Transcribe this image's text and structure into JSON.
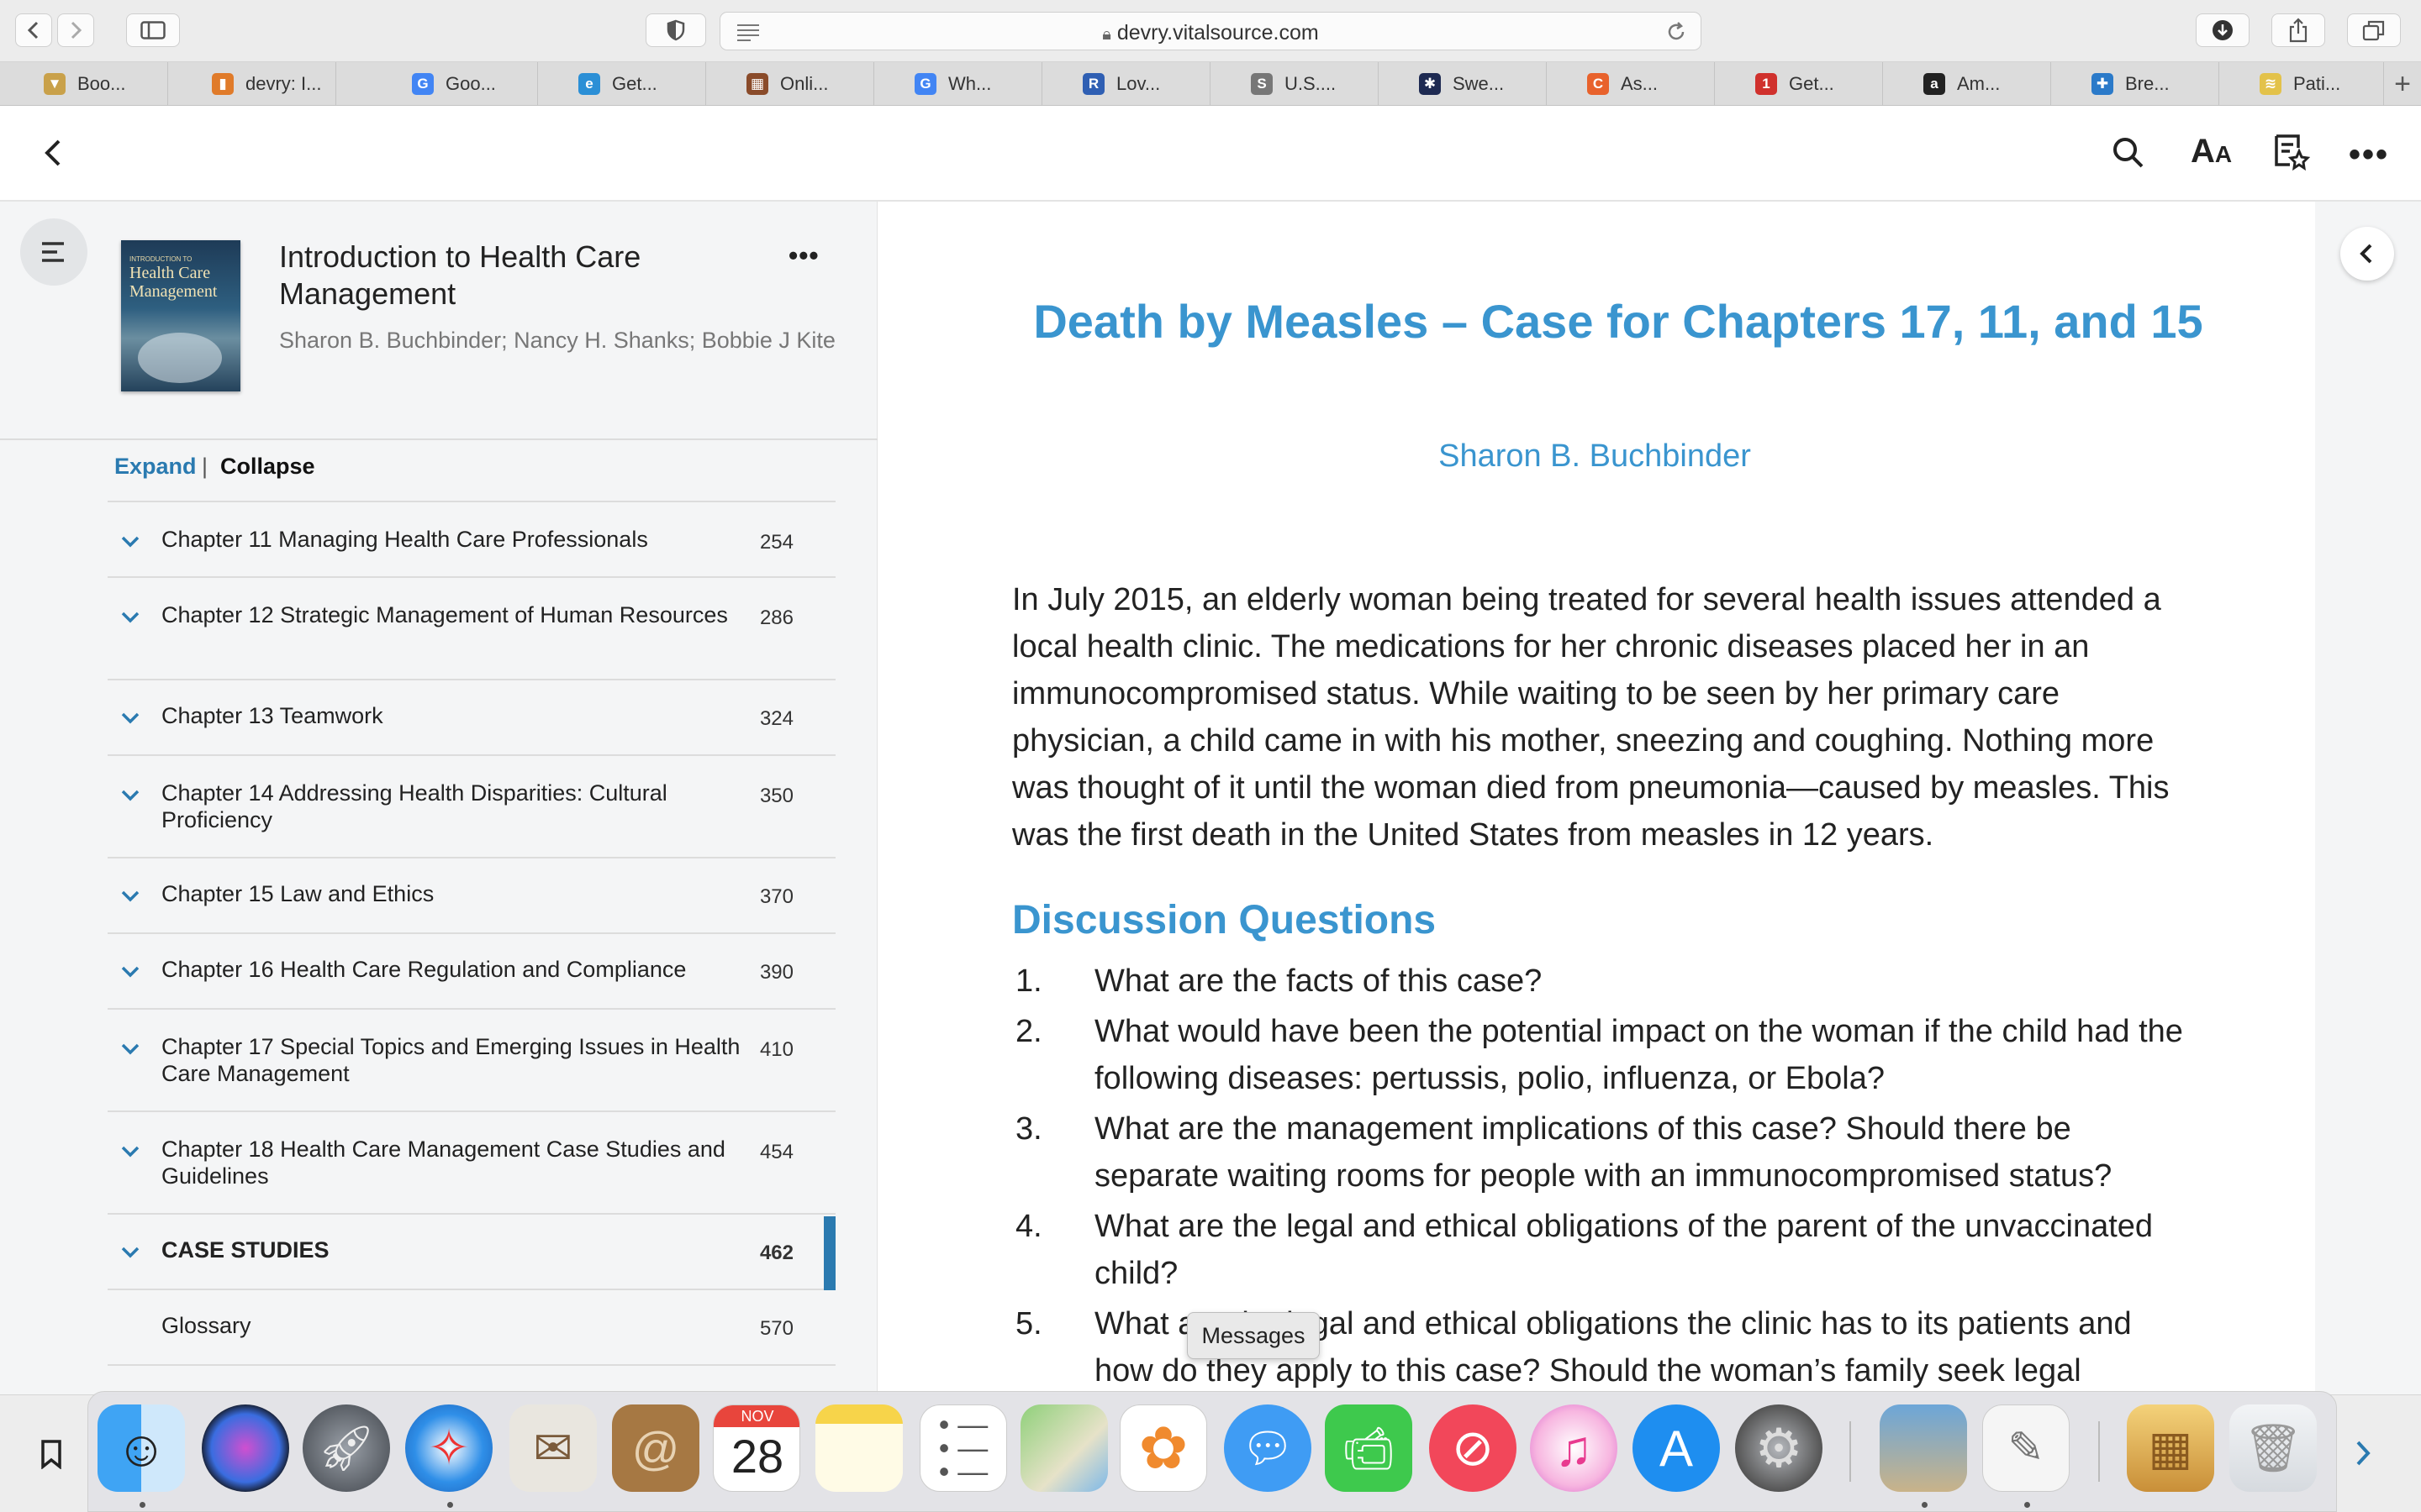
{
  "browser": {
    "url": "devry.vitalsource.com",
    "tabs": [
      {
        "label": "Boo...",
        "color": "#c9a14a",
        "glyph": "▼"
      },
      {
        "label": "devry: I...",
        "color": "#e07b2a",
        "glyph": "▮"
      },
      {
        "label": "Goo...",
        "color": "#4285f4",
        "glyph": "G"
      },
      {
        "label": "Get...",
        "color": "#2b8fd6",
        "glyph": "e"
      },
      {
        "label": "Onli...",
        "color": "#8a4b2a",
        "glyph": "▦"
      },
      {
        "label": "Wh...",
        "color": "#4285f4",
        "glyph": "G"
      },
      {
        "label": "Lov...",
        "color": "#2f5fb3",
        "glyph": "R"
      },
      {
        "label": "U.S....",
        "color": "#777777",
        "glyph": "S"
      },
      {
        "label": "Swe...",
        "color": "#1e2a52",
        "glyph": "✱"
      },
      {
        "label": "As...",
        "color": "#e8622c",
        "glyph": "C"
      },
      {
        "label": "Get...",
        "color": "#d0312d",
        "glyph": "1"
      },
      {
        "label": "Am...",
        "color": "#222222",
        "glyph": "a"
      },
      {
        "label": "Bre...",
        "color": "#2b7ac9",
        "glyph": "✚"
      },
      {
        "label": "Pati...",
        "color": "#e3c24a",
        "glyph": "≋"
      }
    ]
  },
  "book": {
    "title": "Introduction to Health Care Management",
    "authors": "Sharon B. Buchbinder; Nancy H. Shanks; Bobbie J Kite",
    "cover_lines": [
      "INTRODUCTION TO",
      "Health Care",
      "Management"
    ]
  },
  "toc": {
    "expand": "Expand",
    "separator": "|",
    "collapse": "Collapse",
    "items": [
      {
        "label": "Chapter 11 Managing Health Care Professionals",
        "page": "254"
      },
      {
        "label": "Chapter 12 Strategic Management of Human Resources",
        "page": "286"
      },
      {
        "label": "Chapter 13 Teamwork",
        "page": "324"
      },
      {
        "label": "Chapter 14 Addressing Health Disparities: Cultural Proficiency",
        "page": "350"
      },
      {
        "label": "Chapter 15 Law and Ethics",
        "page": "370"
      },
      {
        "label": "Chapter 16 Health Care Regulation and Compliance",
        "page": "390"
      },
      {
        "label": "Chapter 17 Special Topics and Emerging Issues in Health Care Management",
        "page": "410"
      },
      {
        "label": "Chapter 18 Health Care Management Case Studies and Guidelines",
        "page": "454"
      },
      {
        "label": "CASE STUDIES",
        "page": "462"
      },
      {
        "label": "Glossary",
        "page": "570"
      }
    ]
  },
  "content": {
    "title": "Death by Measles – Case for Chapters 17, 11, and 15",
    "author": "Sharon B. Buchbinder",
    "paragraph": "In July 2015, an elderly woman being treated for several health issues attended a local health clinic. The medications for her chronic diseases placed her in an immunocompromised status. While waiting to be seen by her primary care physician, a child came in with his mother, sneezing and coughing. Nothing more was thought of it until the woman died from pneumonia—caused by measles. This was the first death in the United States from measles in 12 years.",
    "discussion_heading": "Discussion Questions",
    "questions": [
      {
        "num": "1.",
        "text": "What are the facts of this case?"
      },
      {
        "num": "2.",
        "text": "What would have been the potential impact on the woman if the child had the following diseases: pertussis, polio, influenza, or Ebola?"
      },
      {
        "num": "3.",
        "text": "What are the management implications of this case? Should there be separate waiting rooms for people with an immunocompromised status?"
      },
      {
        "num": "4.",
        "text": "What are the legal and ethical obligations of the parent of the unvaccinated child?"
      },
      {
        "num": "5.",
        "text": "What are the legal and ethical obligations the clinic has to its patients and how do they apply to this case? Should the woman’s family seek legal"
      }
    ]
  },
  "dock": {
    "tooltip": "Messages",
    "calendar_month": "NOV",
    "calendar_day": "28"
  },
  "colors": {
    "accent": "#3a95cf",
    "heading": "#3a95cf",
    "active_marker": "#2a7ab0"
  }
}
